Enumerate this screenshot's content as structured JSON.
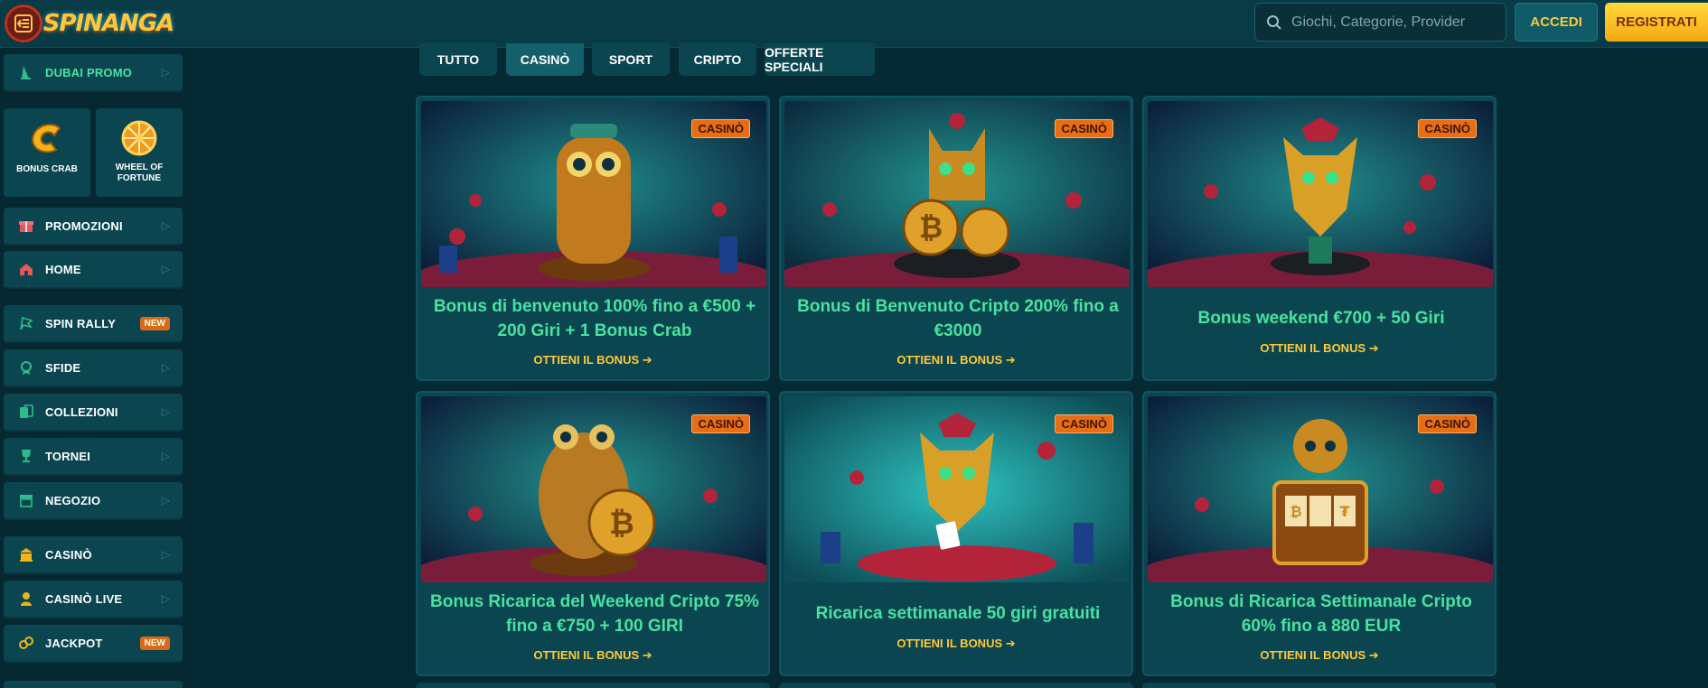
{
  "header": {
    "logo_text": "SPINANGA",
    "search_placeholder": "Giochi, Categorie, Provider",
    "login_label": "ACCEDI",
    "register_label": "REGISTRATI"
  },
  "sidebar": {
    "dubai": "DUBAI PROMO",
    "tiles": [
      "BONUS CRAB",
      "WHEEL OF FORTUNE"
    ],
    "items": [
      {
        "label": "PROMOZIONI"
      },
      {
        "label": "HOME"
      },
      {
        "label": "SPIN RALLY",
        "badge": "NEW"
      },
      {
        "label": "SFIDE"
      },
      {
        "label": "COLLEZIONI"
      },
      {
        "label": "TORNEI"
      },
      {
        "label": "NEGOZIO"
      },
      {
        "label": "CASINÒ"
      },
      {
        "label": "CASINÒ LIVE"
      },
      {
        "label": "JACKPOT",
        "badge": "NEW"
      }
    ]
  },
  "tabs": [
    "TUTTO",
    "CASINÒ",
    "SPORT",
    "CRIPTO",
    "OFFERTE SPECIALI"
  ],
  "active_tab": "CASINÒ",
  "cards": [
    {
      "badge": "CASINÒ",
      "title": "Bonus di benvenuto 100% fino a €500 + 200 Giri + 1 Bonus Crab",
      "cta": "OTTIENI IL BONUS ➔",
      "character": "monkey"
    },
    {
      "badge": "CASINÒ",
      "title": "Bonus di Benvenuto Cripto 200% fino a €3000",
      "cta": "OTTIENI IL BONUS ➔",
      "character": "jaguar"
    },
    {
      "badge": "CASINÒ",
      "title": "Bonus weekend €700 + 50 Giri",
      "cta": "OTTIENI IL BONUS ➔",
      "character": "fox"
    },
    {
      "badge": "CASINÒ",
      "title": "Bonus Ricarica del Weekend Cripto 75% fino a €750 + 100 GIRI",
      "cta": "OTTIENI IL BONUS ➔",
      "character": "frog"
    },
    {
      "badge": "CASINÒ",
      "title": "Ricarica settimanale 50 giri gratuiti",
      "cta": "OTTIENI IL BONUS ➔",
      "character": "lynx"
    },
    {
      "badge": "CASINÒ",
      "title": "Bonus di Ricarica Settimanale Cripto 60% fino a 880 EUR",
      "cta": "OTTIENI IL BONUS ➔",
      "character": "sloth"
    }
  ],
  "colors": {
    "background": "#062a33",
    "panel": "#0b4650",
    "accent_green": "#48e3a0",
    "accent_gold": "#ffc83a",
    "badge_orange": "#e86e16"
  }
}
